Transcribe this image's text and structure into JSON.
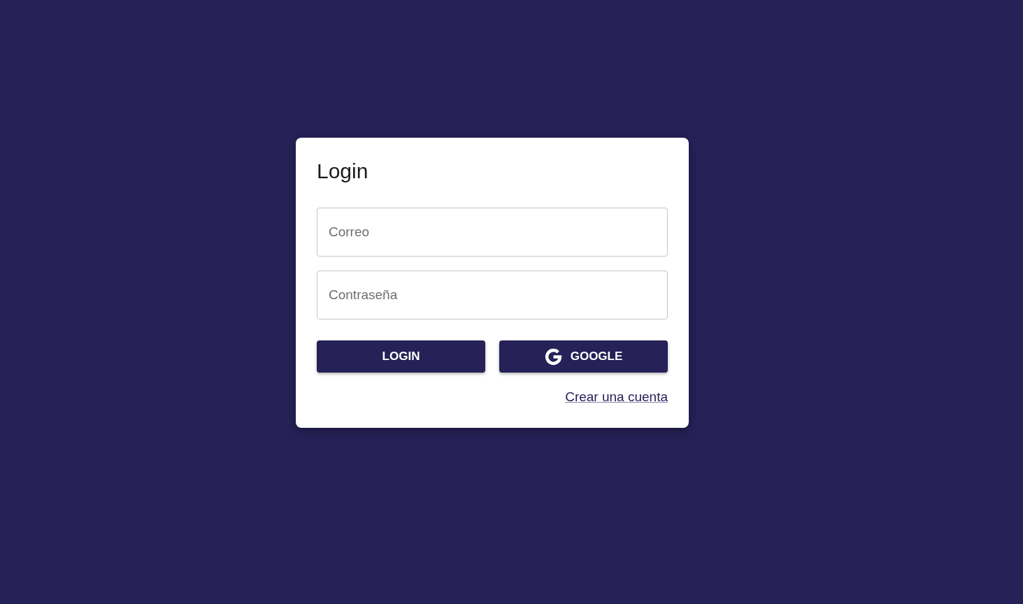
{
  "card": {
    "title": "Login",
    "fields": [
      {
        "placeholder": "Correo"
      },
      {
        "placeholder": "Contraseña"
      }
    ],
    "buttons": [
      {
        "label": "LOGIN",
        "kind": "plain"
      },
      {
        "label": "GOOGLE",
        "kind": "google"
      }
    ],
    "link": "Crear una cuenta"
  }
}
